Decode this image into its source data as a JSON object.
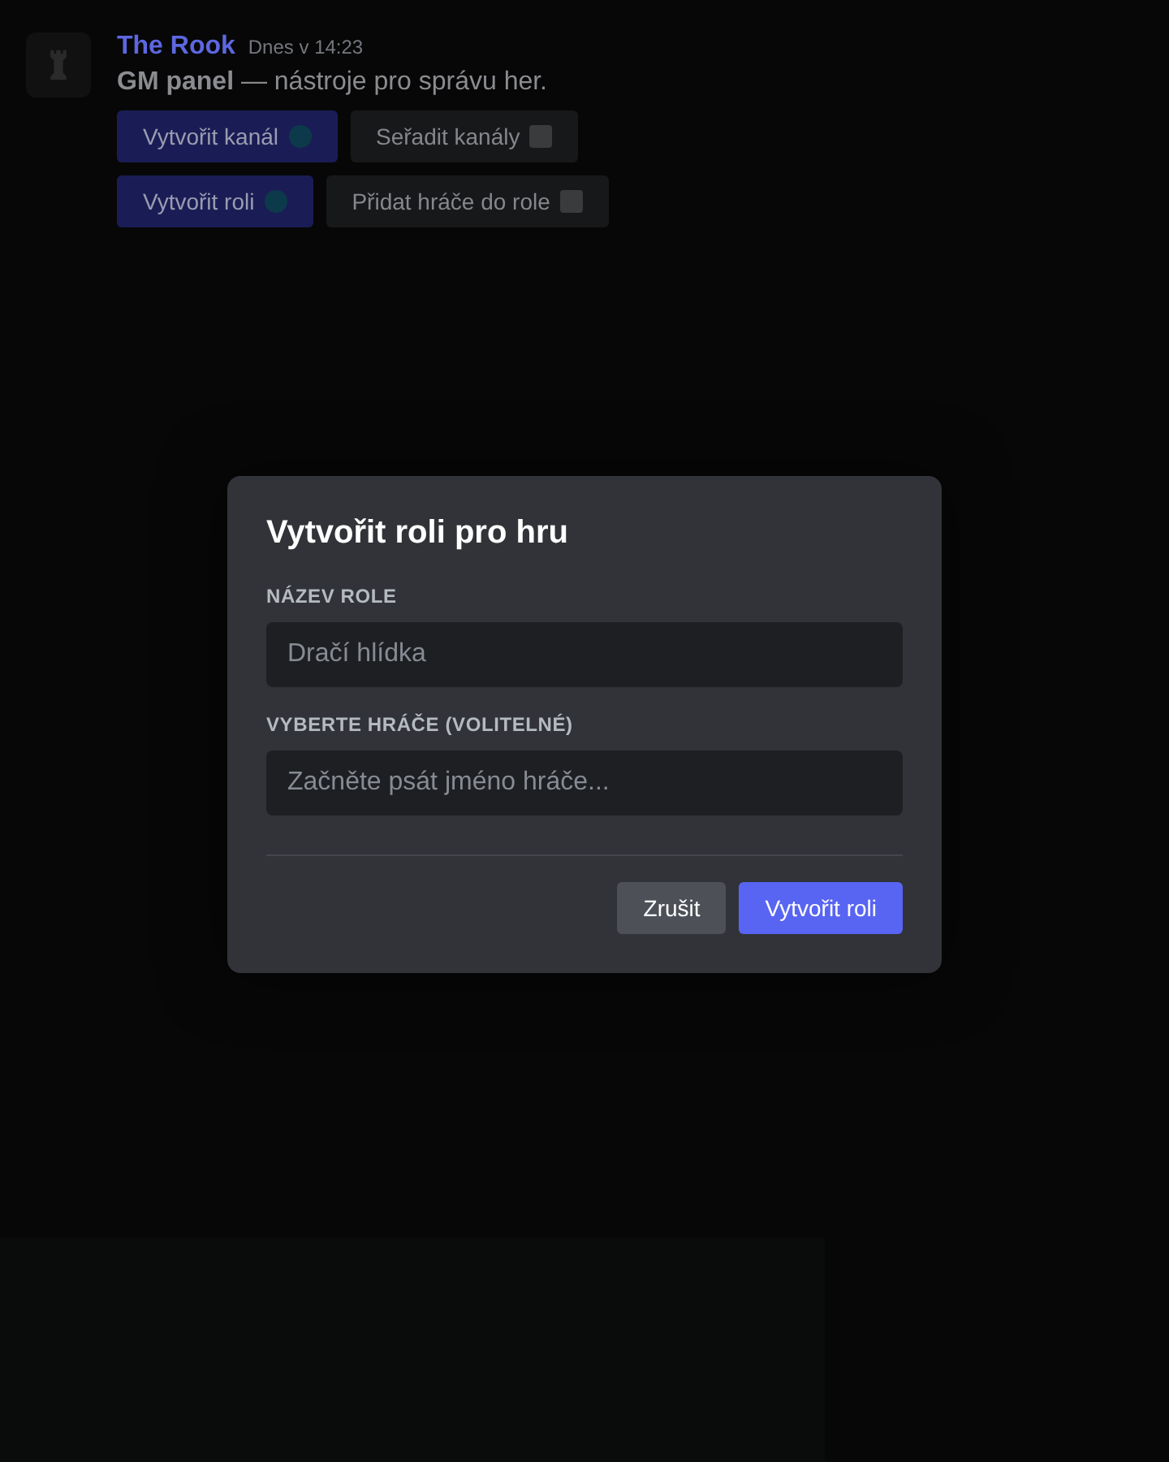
{
  "message": {
    "author": "The Rook",
    "time": "Dnes v 14:23",
    "text": "**GM panel** — nástroje pro správu her.",
    "button_rows": [
      [
        {
          "label": "Vytvořit kanál",
          "kind": "primary"
        },
        {
          "label": "Seřadit kanály",
          "kind": "secondary"
        }
      ],
      [
        {
          "label": "Vytvořit roli",
          "kind": "primary"
        },
        {
          "label": "Přidat hráče do role",
          "kind": "secondary"
        }
      ]
    ]
  },
  "dialog": {
    "title": "Vytvořit roli pro hru",
    "fields": [
      {
        "label": "NÁZEV ROLE",
        "placeholder": "Dračí hlídka"
      },
      {
        "label": "VYBERTE HRÁČE (VOLITELNÉ)",
        "placeholder": "Začněte psát jméno hráče..."
      }
    ],
    "buttons": [
      {
        "label": "Zrušit",
        "kind": "secondary"
      },
      {
        "label": "Vytvořit roli",
        "kind": "primary"
      }
    ]
  }
}
